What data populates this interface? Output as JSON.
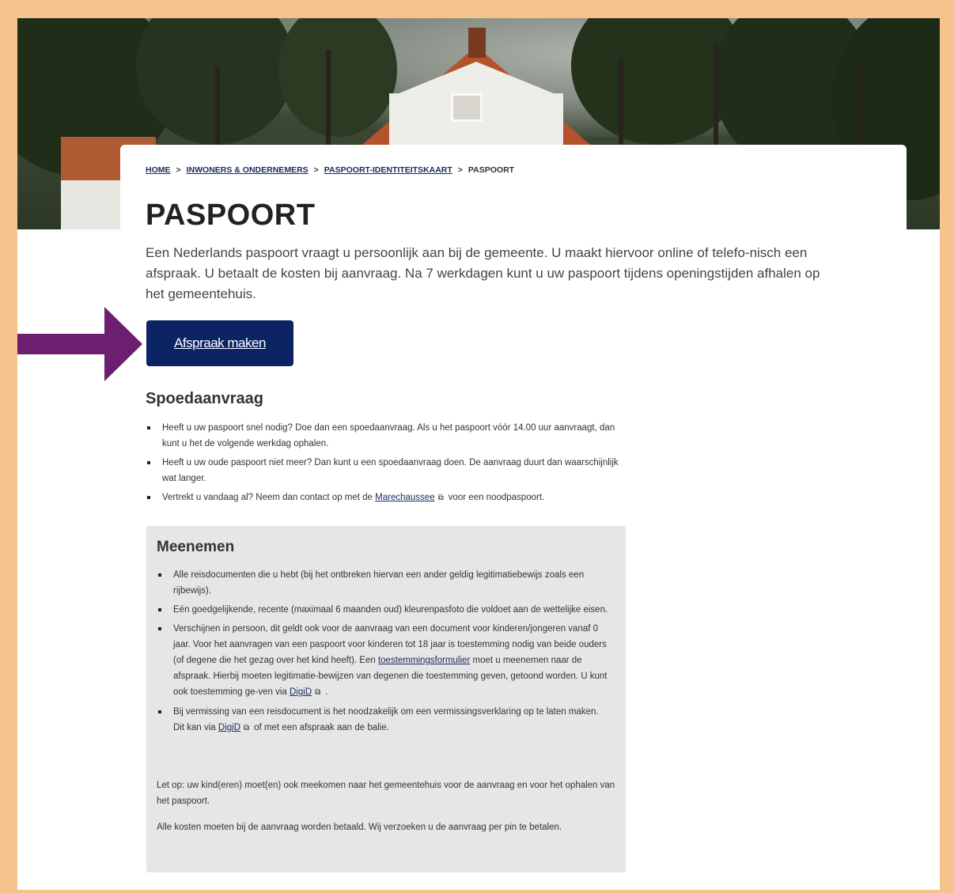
{
  "breadcrumb": {
    "home": "HOME",
    "level2": "INWONERS & ONDERNEMERS",
    "level3": "PASPOORT-IDENTITEITSKAART",
    "current": "PASPOORT",
    "separator": ">"
  },
  "page": {
    "title": "PASPOORT",
    "intro": "Een Nederlands paspoort vraagt u persoonlijk aan bij de gemeente. U maakt hiervoor online of telefo-nisch een afspraak. U betaalt de kosten bij aanvraag. Na 7 werkdagen kunt u uw paspoort tijdens openingstijden afhalen op het gemeentehuis.",
    "cta_label": "Afspraak maken"
  },
  "spoed": {
    "heading": "Spoedaanvraag",
    "items": [
      "Heeft u uw paspoort snel nodig? Doe dan een spoedaanvraag. Als u het paspoort vóór 14.00 uur aanvraagt, dan kunt u het de volgende werkdag ophalen.",
      "Heeft u uw oude paspoort niet meer? Dan kunt u een spoedaanvraag doen. De aanvraag duurt dan waarschijnlijk wat langer."
    ],
    "item3_before": "Vertrekt u vandaag al? Neem dan contact op met de",
    "item3_link": "Marechaussee",
    "item3_after": "voor een noodpaspoort."
  },
  "meenemen": {
    "heading": "Meenemen",
    "item1": "Alle reisdocumenten die u hebt (bij het ontbreken hiervan een ander geldig legitimatiebewijs zoals een rijbewijs).",
    "item2": "Eén goedgelijkende, recente (maximaal 6 maanden oud) kleurenpasfoto die voldoet aan de wettelijke eisen.",
    "item3_a": "Verschijnen in persoon, dit geldt ook voor de aanvraag van een document voor kinderen/jongeren vanaf 0 jaar. Voor het aanvragen van een paspoort voor kinderen tot 18 jaar is toestemming nodig van beide ouders (of degene die het gezag over het kind heeft). Een",
    "item3_link1": "toestemmingsformulier",
    "item3_b": "moet u meenemen naar de afspraak. Hierbij moeten legitimatie-bewijzen van degenen die toestemming geven, getoond worden. U kunt ook toestemming ge-ven via",
    "item3_link2": "DigiD",
    "item3_c": ".",
    "item4_a": "Bij vermissing van een reisdocument is het noodzakelijk om een vermissingsverklaring op te laten maken. Dit kan via",
    "item4_link": "DigiD",
    "item4_b": "of met een afspraak aan de balie.",
    "note1": "Let op: uw kind(eren) moet(en) ook meekomen naar het gemeentehuis voor de aanvraag en voor het ophalen van het paspoort.",
    "note2": "Alle kosten moeten bij de aanvraag worden betaald. Wij verzoeken u de aanvraag per pin te betalen."
  },
  "icons": {
    "external_link": "external-link-icon",
    "arrow": "pointer-arrow-icon"
  },
  "colors": {
    "frame": "#f5c48e",
    "button": "#0c2364",
    "arrow": "#6b1f6e",
    "panel": "#e6e6e6",
    "link": "#1a2a5e"
  }
}
